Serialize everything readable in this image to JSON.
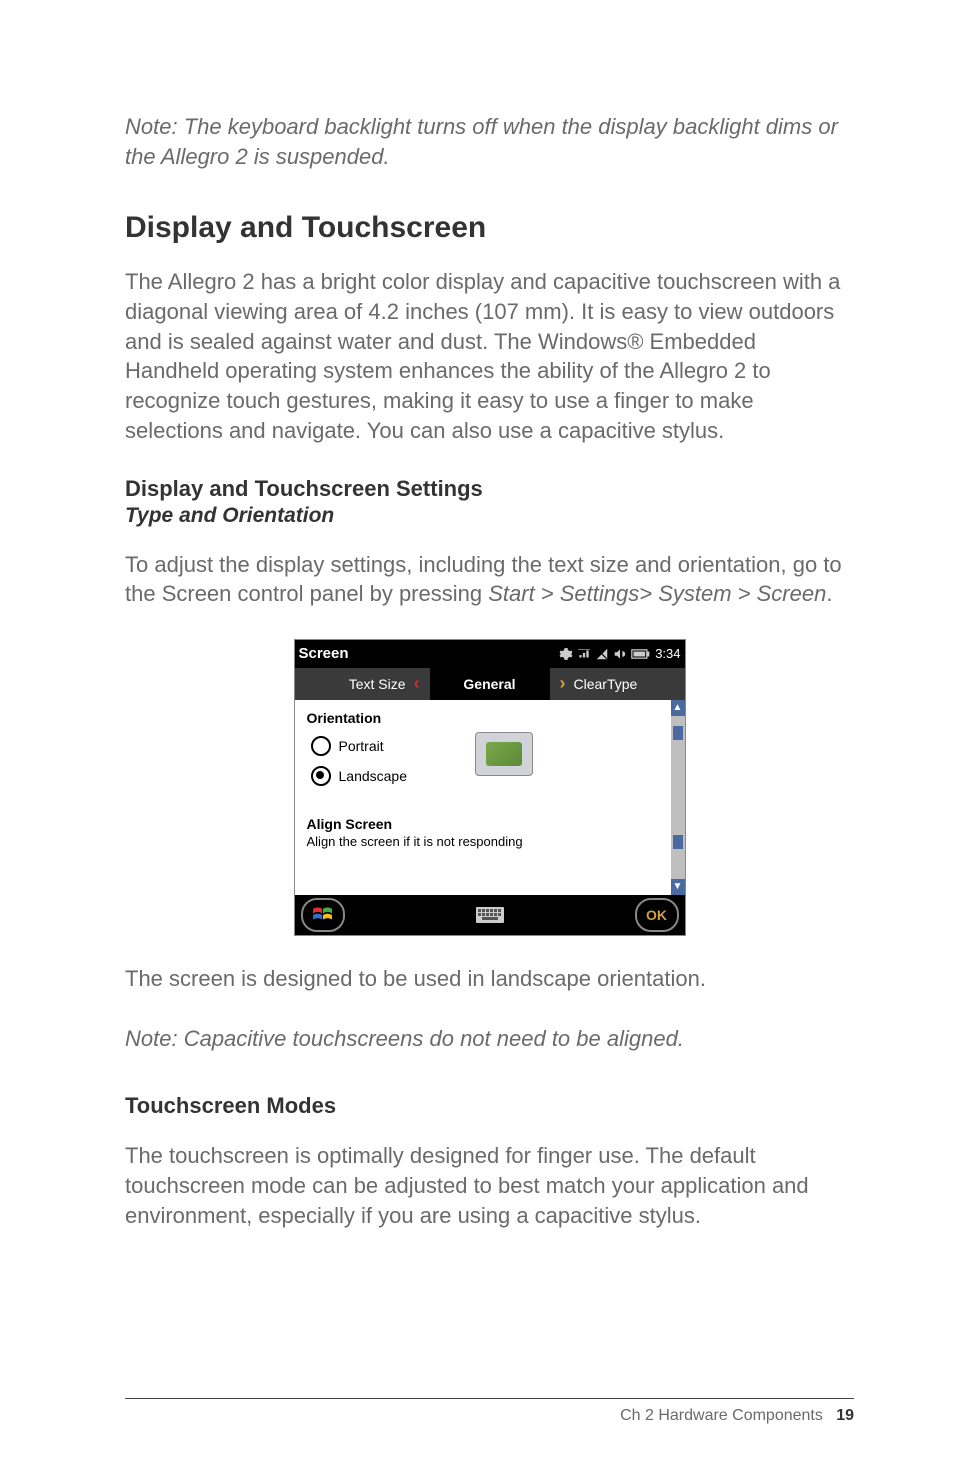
{
  "note_top": "Note: The keyboard backlight turns off when the display backlight dims or the Allegro 2 is suspended.",
  "section_heading": "Display and Touchscreen",
  "section_body": "The Allegro 2 has a bright color display and capacitive touchscreen with a diagonal viewing area of 4.2 inches (107 mm). It is easy to view outdoors and is sealed against water and dust. The Windows® Embedded Handheld operating system enhances the ability of the Allegro 2 to recognize touch gestures, making it easy to use a finger to make selections and navigate. You can also use a capacitive stylus.",
  "settings_heading": "Display and Touchscreen Settings",
  "type_orientation_heading": "Type and Orientation",
  "type_orientation_body_pre": "To adjust the display settings, including the text size and orientation, go to the Screen control panel by pressing ",
  "type_orientation_path": "Start > Settings> System > Screen",
  "type_orientation_body_post": ".",
  "screenshot": {
    "title": "Screen",
    "time": "3:34",
    "tabs": {
      "left": "Text Size",
      "mid": "General",
      "right": "ClearType"
    },
    "orientation_label": "Orientation",
    "radio_portrait": "Portrait",
    "radio_landscape": "Landscape",
    "selected_orientation": "Landscape",
    "align_label": "Align Screen",
    "align_sub": "Align the screen if it is not responding",
    "ok_label": "OK"
  },
  "caption": "The screen is designed to be used in landscape orientation.",
  "note_mid": "Note: Capacitive touchscreens do not need to be aligned.",
  "touch_modes_heading": "Touchscreen Modes",
  "touch_modes_body": "The touchscreen is optimally designed for finger use. The default touchscreen mode can be adjusted to best match your application and environment, especially if you are using a capacitive stylus.",
  "footer": {
    "chapter": "Ch 2   Hardware Components",
    "page": "19"
  }
}
